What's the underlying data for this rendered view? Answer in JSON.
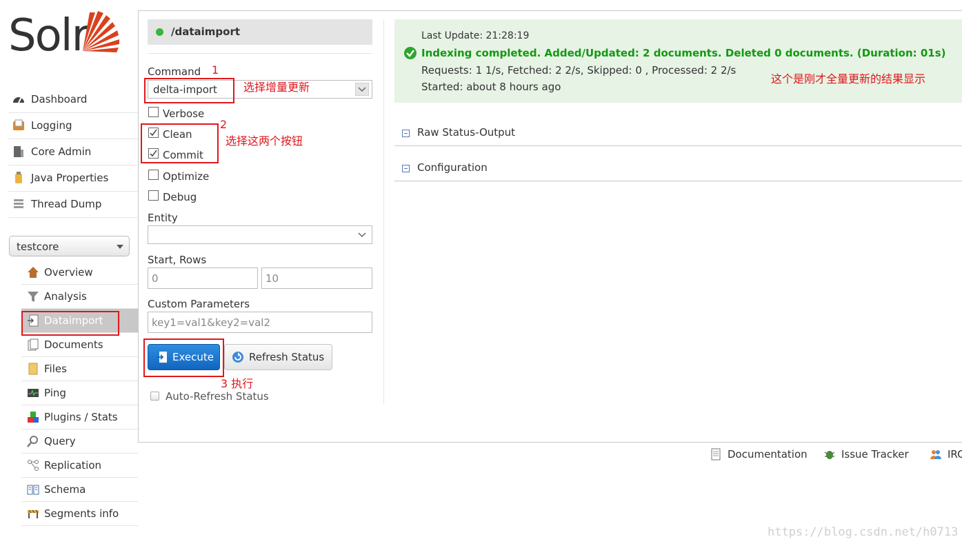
{
  "logo": {
    "text": "Solr"
  },
  "sidebar": {
    "items": [
      {
        "label": "Dashboard",
        "icon": "dashboard-icon"
      },
      {
        "label": "Logging",
        "icon": "logging-icon"
      },
      {
        "label": "Core Admin",
        "icon": "core-admin-icon"
      },
      {
        "label": "Java Properties",
        "icon": "java-properties-icon"
      },
      {
        "label": "Thread Dump",
        "icon": "thread-dump-icon"
      }
    ],
    "core_selector": {
      "value": "testcore"
    },
    "core_items": [
      {
        "label": "Overview",
        "icon": "home-icon"
      },
      {
        "label": "Analysis",
        "icon": "funnel-icon"
      },
      {
        "label": "Dataimport",
        "icon": "dataimport-icon",
        "active": true
      },
      {
        "label": "Documents",
        "icon": "documents-icon"
      },
      {
        "label": "Files",
        "icon": "folder-icon"
      },
      {
        "label": "Ping",
        "icon": "ping-icon"
      },
      {
        "label": "Plugins / Stats",
        "icon": "plugins-icon"
      },
      {
        "label": "Query",
        "icon": "magnifier-icon"
      },
      {
        "label": "Replication",
        "icon": "replication-icon"
      },
      {
        "label": "Schema",
        "icon": "schema-icon"
      },
      {
        "label": "Segments info",
        "icon": "segments-icon"
      }
    ]
  },
  "form": {
    "handler": "/dataimport",
    "command_label": "Command",
    "command_value": "delta-import",
    "options": [
      {
        "label": "Verbose",
        "checked": false
      },
      {
        "label": "Clean",
        "checked": true
      },
      {
        "label": "Commit",
        "checked": true
      },
      {
        "label": "Optimize",
        "checked": false
      },
      {
        "label": "Debug",
        "checked": false
      }
    ],
    "entity_label": "Entity",
    "entity_value": "",
    "start_rows_label": "Start, Rows",
    "start_value": "0",
    "rows_value": "10",
    "custom_params_label": "Custom Parameters",
    "custom_params_placeholder": "key1=val1&key2=val2",
    "execute_label": "Execute",
    "refresh_label": "Refresh Status",
    "auto_refresh_label": "Auto-Refresh Status"
  },
  "status": {
    "last_update": "Last Update: 21:28:19",
    "headline": "Indexing completed. Added/Updated: 2 documents. Deleted 0 documents. (Duration: 01s)",
    "requests": "Requests: 1 1/s, Fetched: 2 2/s, Skipped: 0 , Processed: 2 2/s",
    "started": "Started: about 8 hours ago",
    "success_color": "#119911"
  },
  "sections": [
    {
      "label": "Raw Status-Output"
    },
    {
      "label": "Configuration"
    }
  ],
  "annotations": {
    "step1_num": "1",
    "step1_text": "选择增量更新",
    "step2_num": "2",
    "step2_text": "选择这两个按钮",
    "step3_text": "3 执行",
    "result_note": "这个是刚才全量更新的结果显示",
    "color": "#e0171c"
  },
  "footer": {
    "documentation": "Documentation",
    "issue_tracker": "Issue Tracker",
    "irc": "IRC"
  },
  "watermark": "https://blog.csdn.net/h0713"
}
